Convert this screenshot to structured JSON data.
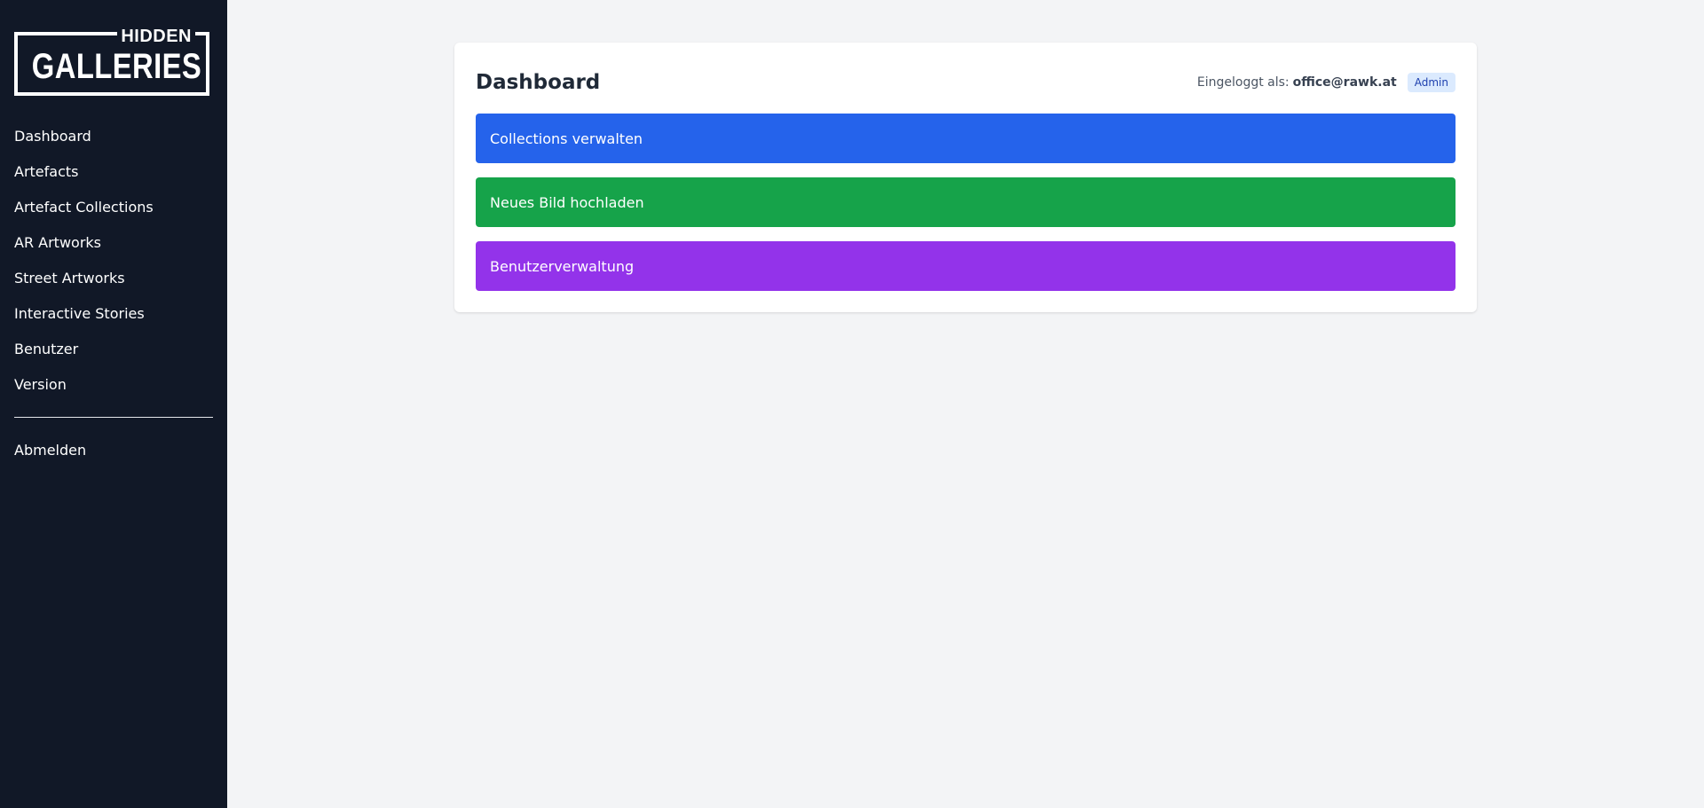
{
  "logo": {
    "line1": "HIDDEN",
    "line2": "GALLERIES"
  },
  "sidebar": {
    "items": [
      {
        "label": "Dashboard"
      },
      {
        "label": "Artefacts"
      },
      {
        "label": "Artefact Collections"
      },
      {
        "label": "AR Artworks"
      },
      {
        "label": "Street Artworks"
      },
      {
        "label": "Interactive Stories"
      },
      {
        "label": "Benutzer"
      },
      {
        "label": "Version"
      }
    ],
    "logout": "Abmelden"
  },
  "header": {
    "title": "Dashboard",
    "logged_in_label": "Eingeloggt als:",
    "email": "office@rawk.at",
    "role_badge": "Admin"
  },
  "actions": [
    {
      "label": "Collections verwalten",
      "color": "#2563eb"
    },
    {
      "label": "Neues Bild hochladen",
      "color": "#16a34a"
    },
    {
      "label": "Benutzerverwaltung",
      "color": "#9333ea"
    }
  ],
  "colors": {
    "sidebar_bg": "#111827",
    "page_bg": "#f3f4f6",
    "badge_bg": "#dbeafe",
    "badge_text": "#1e40af"
  }
}
